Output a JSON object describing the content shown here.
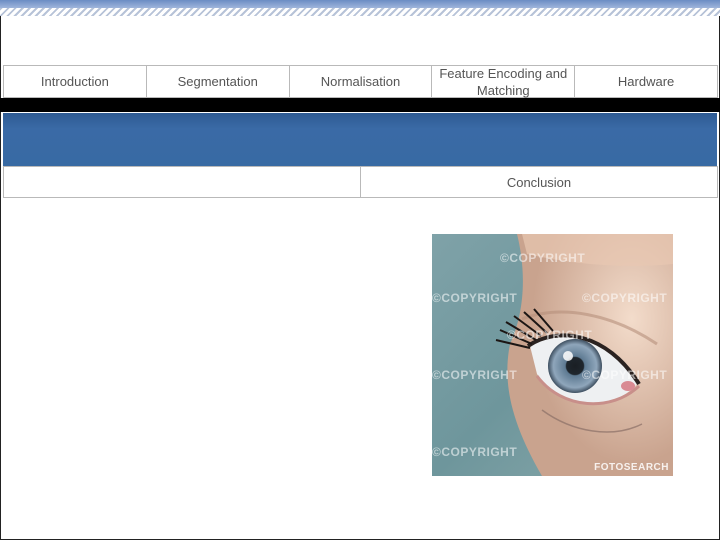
{
  "nav": {
    "items": [
      {
        "label": "Introduction"
      },
      {
        "label": "Segmentation"
      },
      {
        "label": "Normalisation"
      },
      {
        "label": "Feature Encoding and Matching"
      },
      {
        "label": "Hardware"
      }
    ]
  },
  "secondary_nav": {
    "items": [
      {
        "label": ""
      },
      {
        "label": "Conclusion"
      }
    ]
  },
  "photo": {
    "subject": "close-up of a blue-grey eye",
    "watermark": "©COPYRIGHT",
    "credit": "FOTOSEARCH"
  },
  "colors": {
    "band_blue": "#3a6aa6",
    "top_stripe": "#6b8cc4",
    "border_grey": "#b9b9b9",
    "black_bar": "#000000"
  }
}
